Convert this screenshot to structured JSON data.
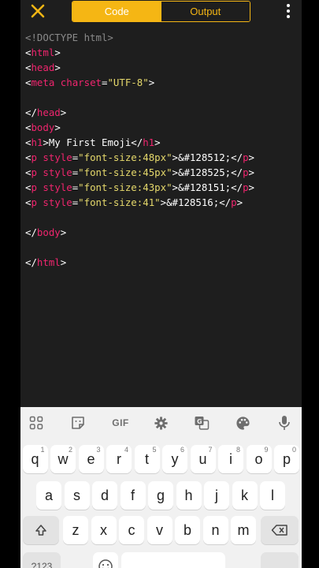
{
  "topbar": {
    "tabs": [
      {
        "label": "Code",
        "active": true
      },
      {
        "label": "Output",
        "active": false
      }
    ]
  },
  "code_lines": [
    [
      {
        "t": "<!DOCTYPE html>",
        "c": "doctype"
      }
    ],
    [
      {
        "t": "<",
        "c": "plain"
      },
      {
        "t": "html",
        "c": "tag"
      },
      {
        "t": ">",
        "c": "plain"
      }
    ],
    [
      {
        "t": "<",
        "c": "plain"
      },
      {
        "t": "head",
        "c": "tag"
      },
      {
        "t": ">",
        "c": "plain"
      }
    ],
    [
      {
        "t": "<",
        "c": "plain"
      },
      {
        "t": "meta",
        "c": "tag"
      },
      {
        "t": " charset",
        "c": "attr"
      },
      {
        "t": "=",
        "c": "plain"
      },
      {
        "t": "\"UTF-8\"",
        "c": "str"
      },
      {
        "t": ">",
        "c": "plain"
      }
    ],
    [],
    [
      {
        "t": "</",
        "c": "plain"
      },
      {
        "t": "head",
        "c": "tag"
      },
      {
        "t": ">",
        "c": "plain"
      }
    ],
    [
      {
        "t": "<",
        "c": "plain"
      },
      {
        "t": "body",
        "c": "tag"
      },
      {
        "t": ">",
        "c": "plain"
      }
    ],
    [
      {
        "t": "<",
        "c": "plain"
      },
      {
        "t": "h1",
        "c": "tag"
      },
      {
        "t": ">My First Emoji</",
        "c": "plain"
      },
      {
        "t": "h1",
        "c": "tag"
      },
      {
        "t": ">",
        "c": "plain"
      }
    ],
    [
      {
        "t": "<",
        "c": "plain"
      },
      {
        "t": "p",
        "c": "tag"
      },
      {
        "t": " style",
        "c": "attr"
      },
      {
        "t": "=",
        "c": "plain"
      },
      {
        "t": "\"font-size:48px\"",
        "c": "str"
      },
      {
        "t": ">&#128512;</",
        "c": "plain"
      },
      {
        "t": "p",
        "c": "tag"
      },
      {
        "t": ">",
        "c": "plain"
      }
    ],
    [
      {
        "t": "<",
        "c": "plain"
      },
      {
        "t": "p",
        "c": "tag"
      },
      {
        "t": " style",
        "c": "attr"
      },
      {
        "t": "=",
        "c": "plain"
      },
      {
        "t": "\"font-size:45px\"",
        "c": "str"
      },
      {
        "t": ">&#128525;</",
        "c": "plain"
      },
      {
        "t": "p",
        "c": "tag"
      },
      {
        "t": ">",
        "c": "plain"
      }
    ],
    [
      {
        "t": "<",
        "c": "plain"
      },
      {
        "t": "p",
        "c": "tag"
      },
      {
        "t": " style",
        "c": "attr"
      },
      {
        "t": "=",
        "c": "plain"
      },
      {
        "t": "\"font-size:43px\"",
        "c": "str"
      },
      {
        "t": ">&#128151;</",
        "c": "plain"
      },
      {
        "t": "p",
        "c": "tag"
      },
      {
        "t": ">",
        "c": "plain"
      }
    ],
    [
      {
        "t": "<",
        "c": "plain"
      },
      {
        "t": "p",
        "c": "tag"
      },
      {
        "t": " style",
        "c": "attr"
      },
      {
        "t": "=",
        "c": "plain"
      },
      {
        "t": "\"font-size:41\"",
        "c": "str"
      },
      {
        "t": ">&#128516;</",
        "c": "plain"
      },
      {
        "t": "p",
        "c": "tag"
      },
      {
        "t": ">",
        "c": "plain"
      }
    ],
    [],
    [
      {
        "t": "</",
        "c": "plain"
      },
      {
        "t": "body",
        "c": "tag"
      },
      {
        "t": ">",
        "c": "plain"
      }
    ],
    [],
    [
      {
        "t": "</",
        "c": "plain"
      },
      {
        "t": "html",
        "c": "tag"
      },
      {
        "t": ">",
        "c": "plain"
      }
    ]
  ],
  "keyboard": {
    "toolbar": {
      "gif_label": "GIF",
      "icons": [
        "apps-grid-icon",
        "sticker-icon",
        "gif-icon",
        "settings-gear-icon",
        "translate-icon",
        "palette-icon",
        "microphone-icon"
      ]
    },
    "row1": [
      {
        "k": "q",
        "h": "1"
      },
      {
        "k": "w",
        "h": "2"
      },
      {
        "k": "e",
        "h": "3"
      },
      {
        "k": "r",
        "h": "4"
      },
      {
        "k": "t",
        "h": "5"
      },
      {
        "k": "y",
        "h": "6"
      },
      {
        "k": "u",
        "h": "7"
      },
      {
        "k": "i",
        "h": "8"
      },
      {
        "k": "o",
        "h": "9"
      },
      {
        "k": "p",
        "h": "0"
      }
    ],
    "row2": [
      "a",
      "s",
      "d",
      "f",
      "g",
      "h",
      "j",
      "k",
      "l"
    ],
    "row3": [
      "z",
      "x",
      "c",
      "v",
      "b",
      "n",
      "m"
    ],
    "numbers_key": "?123"
  },
  "colors": {
    "accent": "#f5b614",
    "tag": "#f0256e",
    "string": "#e5d86b",
    "editor_bg": "#1e1e1e"
  }
}
